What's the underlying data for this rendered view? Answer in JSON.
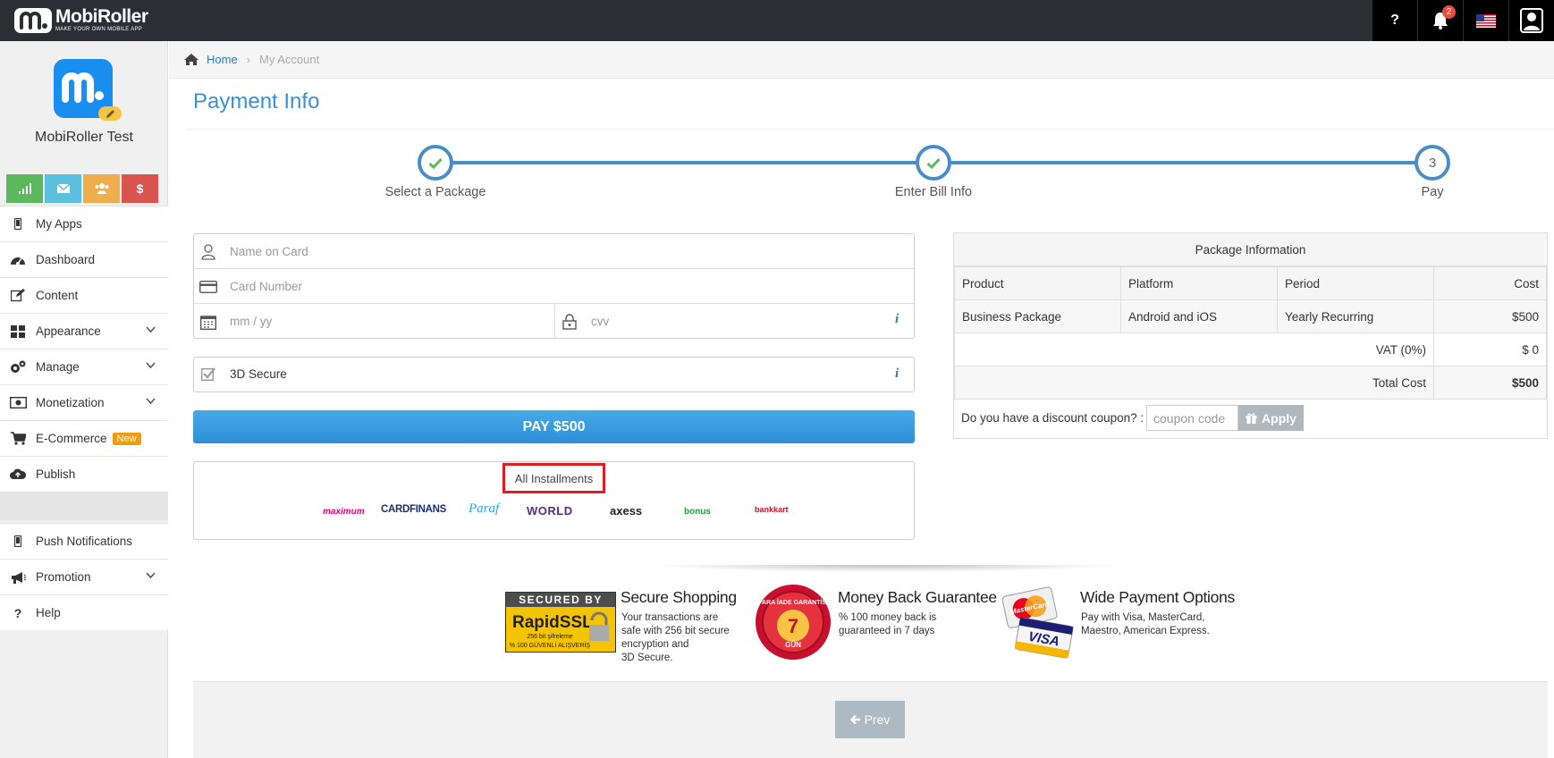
{
  "topbar": {
    "brand_name": "MobiRoller",
    "brand_tagline": "MAKE YOUR OWN MOBILE APP",
    "help_label": "?",
    "notification_count": "2"
  },
  "sidebar": {
    "app_name": "MobiRoller Test",
    "quick_buttons": [
      {
        "icon": "signal-icon",
        "color": "#5cb85c"
      },
      {
        "icon": "envelope-icon",
        "color": "#5bc0de"
      },
      {
        "icon": "users-icon",
        "color": "#f0ad4e"
      },
      {
        "icon": "dollar-icon",
        "color": "#d9534f"
      }
    ],
    "items": [
      {
        "label": "My Apps",
        "icon": "mobile-icon"
      },
      {
        "label": "Dashboard",
        "icon": "dashboard-icon"
      },
      {
        "label": "Content",
        "icon": "edit-icon"
      },
      {
        "label": "Appearance",
        "icon": "grid-icon"
      },
      {
        "label": "Manage",
        "icon": "gears-icon"
      },
      {
        "label": "Monetization",
        "icon": "money-icon"
      },
      {
        "label": "E-Commerce",
        "icon": "cart-icon",
        "badge": "New"
      },
      {
        "label": "Publish",
        "icon": "cloud-upload-icon"
      },
      {
        "label": "Push Notifications",
        "icon": "mobile-icon"
      },
      {
        "label": "Promotion",
        "icon": "megaphone-icon"
      },
      {
        "label": "Help",
        "icon": "question-icon"
      }
    ]
  },
  "breadcrumb": {
    "home": "Home",
    "current": "My Account"
  },
  "page": {
    "title": "Payment Info"
  },
  "steps": [
    {
      "label": "Select a Package",
      "state": "done"
    },
    {
      "label": "Enter Bill Info",
      "state": "done"
    },
    {
      "label": "Pay",
      "state": "current",
      "number": "3"
    }
  ],
  "card_form": {
    "name_placeholder": "Name on Card",
    "number_placeholder": "Card Number",
    "expiry_placeholder": "mm / yy",
    "cvv_placeholder": "cvv",
    "info_glyph": "i",
    "secure_label": "3D Secure"
  },
  "pay_button": "PAY $500",
  "installments": {
    "button": "All Installments",
    "banks": [
      {
        "name": "maximum",
        "color": "#e6007e"
      },
      {
        "name": "CARDFINANS",
        "color": "#1b2f6b"
      },
      {
        "name": "Paraf",
        "color": "#29a9e0"
      },
      {
        "name": "WORLD",
        "color": "#5a2d82"
      },
      {
        "name": "axess",
        "color": "#222222"
      },
      {
        "name": "bonus",
        "color": "#2a9d3f"
      },
      {
        "name": "bankkart",
        "color": "#c8102e"
      }
    ]
  },
  "package_info": {
    "title": "Package Information",
    "headers": [
      "Product",
      "Platform",
      "Period",
      "Cost"
    ],
    "row": [
      "Business Package",
      "Android and iOS",
      "Yearly Recurring",
      "$500"
    ],
    "vat_label": "VAT (0%)",
    "vat_value": "$ 0",
    "total_label": "Total Cost",
    "total_value": "$500",
    "coupon_label": "Do you have a discount coupon? :",
    "coupon_placeholder": "coupon code",
    "apply_label": "Apply"
  },
  "trust": [
    {
      "title": "Secure Shopping",
      "text": [
        "Your transactions are",
        "safe with 256 bit secure",
        "encryption and",
        "3D Secure."
      ],
      "badge_top": "SECURED BY",
      "badge_main": "RapidSSL",
      "badge_l1": "256 bit şifreleme",
      "badge_l2": "% 100 GÜVENLİ ALIŞVERİŞ"
    },
    {
      "title": "Money Back Guarantee",
      "text": [
        "% 100 money back is",
        "guaranteed in 7 days"
      ],
      "seal_top": "PARA İADE GARANTİSİ",
      "seal_num": "7",
      "seal_word": "GÜN"
    },
    {
      "title": "Wide Payment Options",
      "text": [
        "Pay with Visa, MasterCard,",
        "Maestro, American Express."
      ],
      "card1": "MasterCard",
      "card2": "VISA"
    }
  ],
  "footer": {
    "prev_label": "Prev"
  },
  "colors": {
    "accent": "#3d8fd1",
    "step": "#4a8ec7",
    "check": "#5cb85c"
  }
}
